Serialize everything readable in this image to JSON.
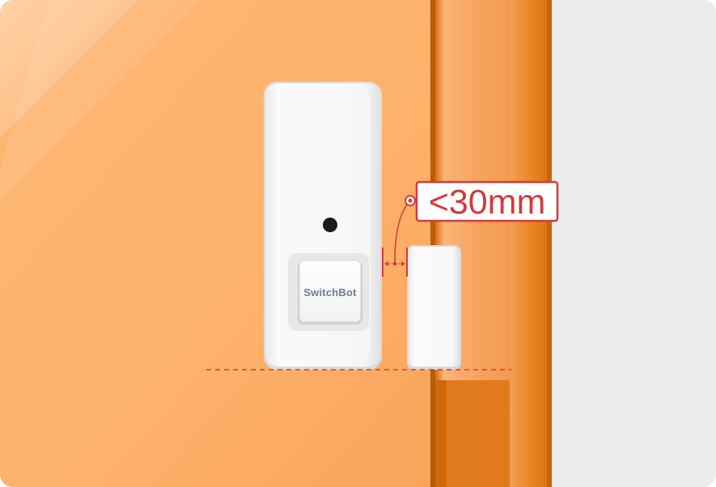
{
  "illustration": {
    "brand_text": "SwitchBot",
    "gap_annotation": "<30mm",
    "colors": {
      "door_orange": "#fdb06a",
      "frame_orange": "#e8872a",
      "wall_gray": "#ececec",
      "device_white": "#f4f4f4",
      "annotation_red": "#d23b3b"
    },
    "icons": [
      "contact-sensor-main-unit",
      "magnet-unit",
      "gap-arrow-icon"
    ]
  }
}
